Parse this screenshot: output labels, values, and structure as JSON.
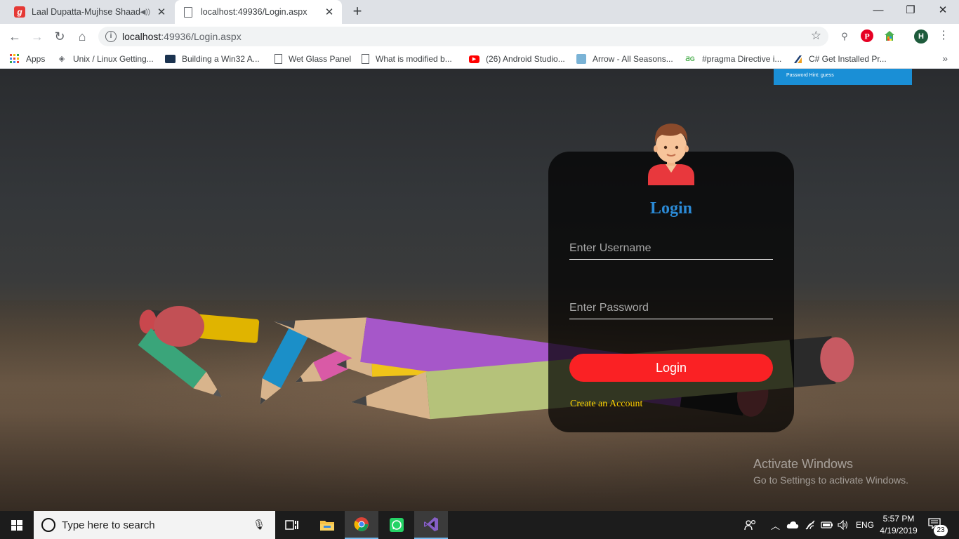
{
  "browser": {
    "tabs": [
      {
        "title": "Laal Dupatta-Mujhse Shaadi",
        "favicon": "g",
        "audio": true
      },
      {
        "title": "localhost:49936/Login.aspx",
        "favicon": "doc"
      }
    ],
    "url_host": "localhost",
    "url_rest": ":49936/Login.aspx",
    "profile_initial": "H",
    "bookmarks": [
      {
        "label": "Apps",
        "icon": "apps-grid-icon"
      },
      {
        "label": "Unix / Linux Getting...",
        "icon": "diamond-icon"
      },
      {
        "label": "Building a Win32 A...",
        "icon": "monitor-icon"
      },
      {
        "label": "Wet Glass Panel",
        "icon": "page-icon"
      },
      {
        "label": "What is modified b...",
        "icon": "page-icon"
      },
      {
        "label": "(26) Android Studio...",
        "icon": "youtube-icon"
      },
      {
        "label": "Arrow - All Seasons...",
        "icon": "arrow-site-icon"
      },
      {
        "label": "#pragma Directive i...",
        "icon": "dg-icon"
      },
      {
        "label": "C# Get Installed Pr...",
        "icon": "csharp-icon"
      }
    ]
  },
  "page": {
    "hint": "Password Hint: guess",
    "title": "Login",
    "username_placeholder": "Enter Username",
    "password_placeholder": "Enter Password",
    "login_button": "Login",
    "create_account": "Create an Account",
    "watermark_line1": "Activate Windows",
    "watermark_line2": "Go to Settings to activate Windows."
  },
  "taskbar": {
    "search_placeholder": "Type here to search",
    "language": "ENG",
    "time": "5:57 PM",
    "date": "4/19/2019",
    "notification_count": "23"
  },
  "colors": {
    "login_title": "#2b8ad6",
    "login_button": "#fa2124",
    "create_link": "#ffd200",
    "hint_banner": "#1a8fd6"
  }
}
